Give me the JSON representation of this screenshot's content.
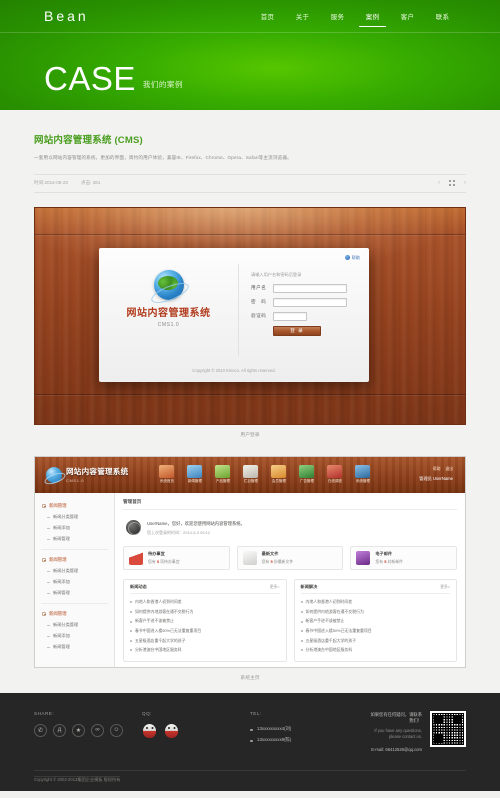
{
  "header": {
    "logo": "Bean",
    "nav": [
      {
        "label": "首页",
        "active": false
      },
      {
        "label": "关于",
        "active": false
      },
      {
        "label": "服务",
        "active": false
      },
      {
        "label": "案例",
        "active": true
      },
      {
        "label": "客户",
        "active": false
      },
      {
        "label": "联系",
        "active": false
      }
    ],
    "hero_title": "CASE",
    "hero_sub": "我们的案例"
  },
  "article": {
    "title": "网站内容管理系统 (CMS)",
    "desc": "一套用以网站内容管理的系统，更加的界面，简约的用户体验，兼容IE、Firefox、Chrome、Opera、Safari等主流浏览器。",
    "meta_date": "时间:2014-05-23",
    "meta_hits": "点击: 381",
    "nav_prev": "‹",
    "nav_grid": "grid-icon",
    "nav_next": "›"
  },
  "shot1": {
    "caption": "用户登录",
    "help": "帮助",
    "brand_cn": "网站内容管理系统",
    "brand_ver": "CMS1.0",
    "tip": "请输入用户名和密码后登录",
    "fields": [
      {
        "label": "用户名",
        "value": ""
      },
      {
        "label": "密　码",
        "value": ""
      },
      {
        "label": "验证码",
        "value": ""
      }
    ],
    "login_button": "登 录",
    "footer": "Copyright © 2010 Kinoco. All rights reserved."
  },
  "shot2": {
    "caption": "系统主页",
    "brand_cn": "网站内容管理系统",
    "brand_ver": "CMS1.0",
    "tools": [
      {
        "label": "系统首页",
        "color": "#d9663a"
      },
      {
        "label": "新闻管理",
        "color": "#5b9ccd"
      },
      {
        "label": "产品管理",
        "color": "#8bbf4a"
      },
      {
        "label": "栏目管理",
        "color": "#d8d4cc"
      },
      {
        "label": "会员管理",
        "color": "#e8a33d"
      },
      {
        "label": "广告管理",
        "color": "#4f9f4a"
      },
      {
        "label": "在线调查",
        "color": "#c8423f"
      },
      {
        "label": "系统管理",
        "color": "#3f7fb5"
      }
    ],
    "user_links": [
      "帮助",
      "退出"
    ],
    "user_name": "管理员 UserName",
    "panel_title": "管理首页",
    "welcome_line1": "UserName，您好，欢迎您使用网站内容管理系统。",
    "welcome_line2": "您上次登录的时间：2014-5-3 09:12",
    "sidebar": [
      {
        "parent": "新闻管理",
        "children": [
          "新闻分类管理",
          "新闻添加",
          "新闻管理"
        ]
      },
      {
        "parent": "新闻管理",
        "children": [
          "新闻分类管理",
          "新闻添加",
          "新闻管理"
        ]
      },
      {
        "parent": "新闻管理",
        "children": [
          "新闻分类管理",
          "新闻添加",
          "新闻管理"
        ]
      }
    ],
    "stats": [
      {
        "title": "待办事宜",
        "sub_pre": "您有",
        "count": "5",
        "sub_post": "项待办事宜",
        "color": "#d94a3d"
      },
      {
        "title": "最新文件",
        "sub_pre": "您有",
        "count": "5",
        "sub_post": "份最新文件",
        "color": "#d9d9d7"
      },
      {
        "title": "电子邮件",
        "sub_pre": "您有",
        "count": "5",
        "sub_post": "封新邮件",
        "color": "#8e3fa8"
      }
    ],
    "lists": [
      {
        "title": "新闻动态",
        "more": "更多>",
        "items": [
          "内地人和香港人初到时间差",
          "如何提供内地游客在通不交税行为",
          "新客户手进不该被禁止",
          "春节中国进入楼50%已无法重复重项目",
          "五星级酒店重千起大学的孩子",
          "分析港澳台中国地区服务科"
        ]
      },
      {
        "title": "新闻解决",
        "more": "更多>",
        "items": [
          "内地人和香港人初到时间差",
          "如何提供内地游客在通不交税行为",
          "新客户手进不该被禁止",
          "春节中国进入楼50%已无法重复重项目",
          "五星级酒店重千起大学的孩子",
          "分析港澳台中国地区服务科"
        ]
      }
    ]
  },
  "footer": {
    "share_title": "SHARE:",
    "share_icons": [
      "weixin-icon",
      "renren-icon",
      "star-icon",
      "douban-icon",
      "kaixin-icon"
    ],
    "qq_title": "QQ:",
    "qq_icons": [
      "qq-icon",
      "qq-icon"
    ],
    "tel_title": "TEL:",
    "tels": [
      "13xxxxxxxxx4(刘)",
      "13xxxxxxxxx9(陈)"
    ],
    "contact_cn": "如果您有任何疑问，请联系我们！",
    "contact_en1": "If you have any questions,",
    "contact_en2": "please contact us.",
    "email": "E-mail: 66412526@qq.com",
    "qr": "qr-code",
    "copyright": "Copyright © 2002-2013集团企业模板 版权所有"
  }
}
